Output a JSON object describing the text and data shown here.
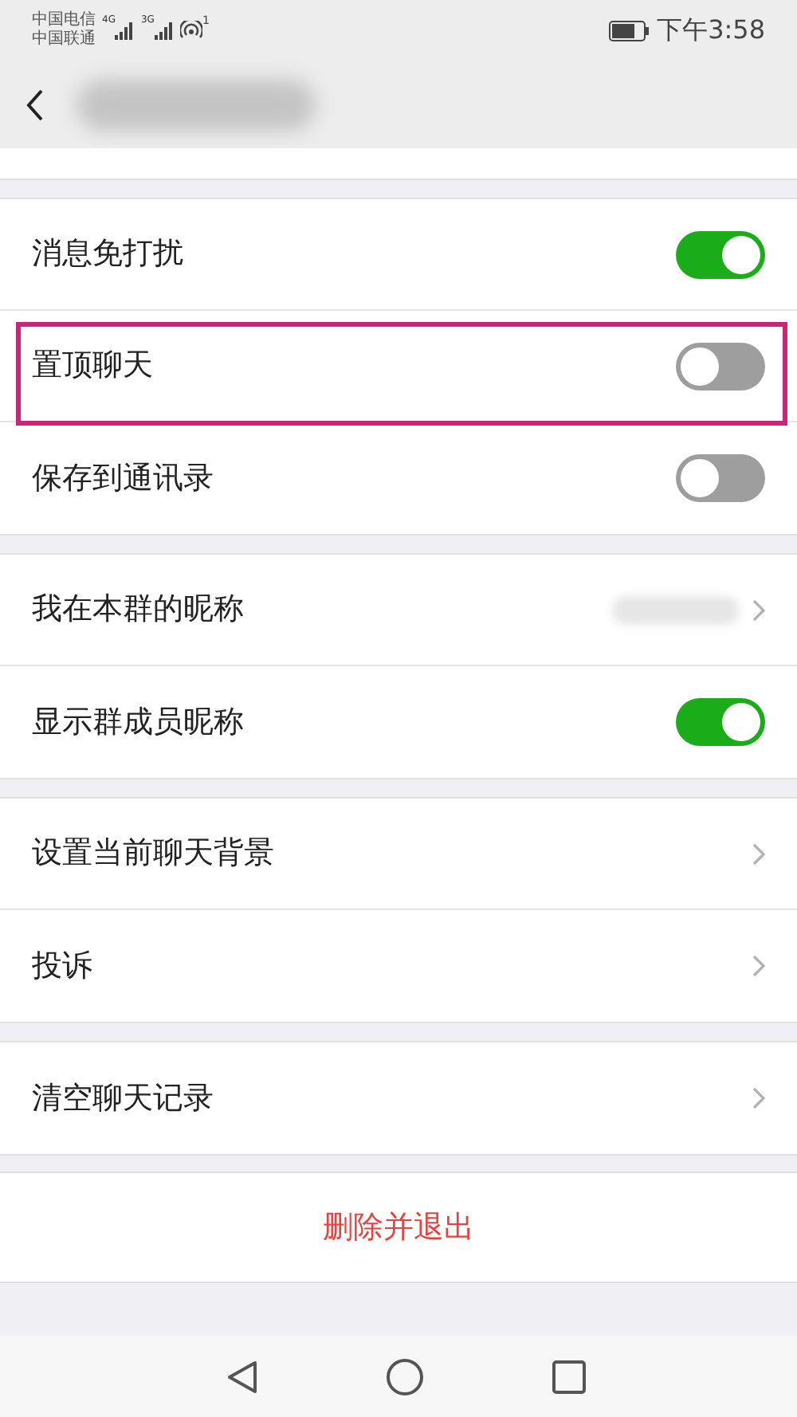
{
  "status_bar": {
    "carrier_1": "中国电信",
    "carrier_2": "中国联通",
    "network_1": "4G",
    "network_2": "3G",
    "hotspot_count": "1",
    "time": "下午3:58"
  },
  "sections": [
    {
      "rows": [
        {
          "kind": "toggle",
          "label": "消息免打扰",
          "on": true,
          "highlighted": false
        },
        {
          "kind": "toggle",
          "label": "置顶聊天",
          "on": false,
          "highlighted": true
        },
        {
          "kind": "toggle",
          "label": "保存到通讯录",
          "on": false,
          "highlighted": false
        }
      ]
    },
    {
      "rows": [
        {
          "kind": "value",
          "label": "我在本群的昵称",
          "highlighted": false
        },
        {
          "kind": "toggle",
          "label": "显示群成员昵称",
          "on": true,
          "highlighted": false
        }
      ]
    },
    {
      "rows": [
        {
          "kind": "link",
          "label": "设置当前聊天背景",
          "highlighted": false
        },
        {
          "kind": "link",
          "label": "投诉",
          "highlighted": false
        }
      ]
    },
    {
      "rows": [
        {
          "kind": "link",
          "label": "清空聊天记录",
          "highlighted": false
        }
      ]
    }
  ],
  "delete_button": "删除并退出"
}
